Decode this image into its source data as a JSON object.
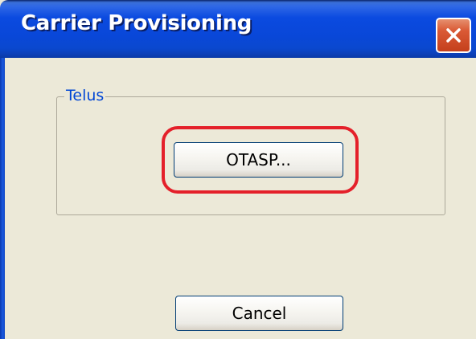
{
  "window": {
    "title": "Carrier Provisioning",
    "close_icon": "close-icon"
  },
  "groupbox": {
    "label": "Telus"
  },
  "buttons": {
    "otasp_label": "OTASP...",
    "cancel_label": "Cancel"
  },
  "annotation": {
    "highlight_color": "#e4202a"
  },
  "colors": {
    "titlebar": "#0b4ae0",
    "window_bg": "#ece9d8",
    "groupbox_label": "#0046d5",
    "close_button": "#da5a36"
  }
}
